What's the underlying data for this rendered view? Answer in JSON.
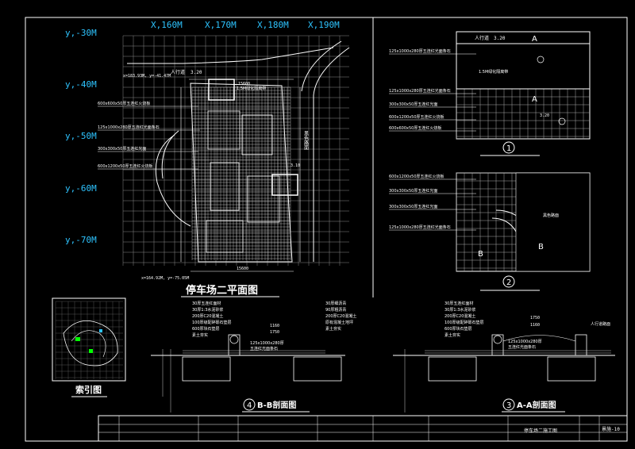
{
  "colors": {
    "background": "#000000",
    "frame": "#ffffff",
    "cyan": "#2ec4ff",
    "grid": "#bbbbbb",
    "highlight": "#00ff00"
  },
  "coords": {
    "x_labels": [
      "X,160M",
      "X,170M",
      "X,180M",
      "X,190M"
    ],
    "y_labels": [
      "y,-30M",
      "y,-40M",
      "y,-50M",
      "y,-60M",
      "y,-70M"
    ]
  },
  "plan": {
    "title": "停车场二平面图",
    "road_label": "人行道",
    "road_level": "3.20",
    "green_strip": "1.5M绿化隔离带",
    "black_pave": "黑色路面",
    "coord_top": "x=183.93M, y=-41.47M",
    "coord_bottom": "x=164.92M, y=-75.05M",
    "dim_total": "15600",
    "level_center": "3.10",
    "notes": [
      "600x600x50厚五连红火烧板",
      "125x1000x280厚五连红光面条石",
      "300x300x50厚五连红光面",
      "600x1200x50厚五连红火烧板"
    ]
  },
  "detail1": {
    "num": "1",
    "road_label": "人行道",
    "level": "3.20",
    "green": "1.5M绿化隔离带",
    "section": "A",
    "level2": "3.20",
    "notes": [
      "125x1000x280厚五连红光面条石",
      "125x1000x280厚五连红光面条石",
      "300x300x50厚五连红光面",
      "600x1200x50厚五连红火烧板",
      "600x600x50厚五连红火烧板"
    ]
  },
  "detail2": {
    "num": "2",
    "black": "黑色路面",
    "section": "B",
    "notes": [
      "600x1200x50厚五连红火烧板",
      "300x300x50厚五连红光面",
      "300x300x50厚五连红光面",
      "125x1000x280厚五连红光面条石"
    ]
  },
  "index": {
    "title": "索引图"
  },
  "section_bb": {
    "num": "4",
    "title": "B-B剖面图",
    "layers_a": [
      "30厚五连红面材",
      "30厚1:3水泥砂浆",
      "200厚C20混凝土",
      "100厚级配碎砾石垫层",
      "600厚块石垫层",
      "素土夯实"
    ],
    "layers_b": [
      "30厚细沥青",
      "90厚粗沥青",
      "200厚C20混凝土",
      "原有混凝土地坪",
      "素土夯实"
    ],
    "kerb": "125x1000x280厚",
    "kerb2": "五连红光面条石",
    "dims": [
      "1160",
      "1750"
    ]
  },
  "section_aa": {
    "num": "3",
    "title": "A-A剖面图",
    "layers": [
      "30厚五连红面材",
      "30厚1:3水泥砂浆",
      "200厚C20混凝土",
      "100厚级配碎砾石垫层",
      "600厚块石垫层",
      "素土夯实"
    ],
    "kerb": "125x1000x280厚",
    "kerb2": "五连红光面条石",
    "walk": "人行道路面",
    "dims": [
      "1750",
      "1160"
    ]
  },
  "title_block": {
    "drawing_name": "停车场二施工图",
    "drawing_no": "景施-10"
  }
}
